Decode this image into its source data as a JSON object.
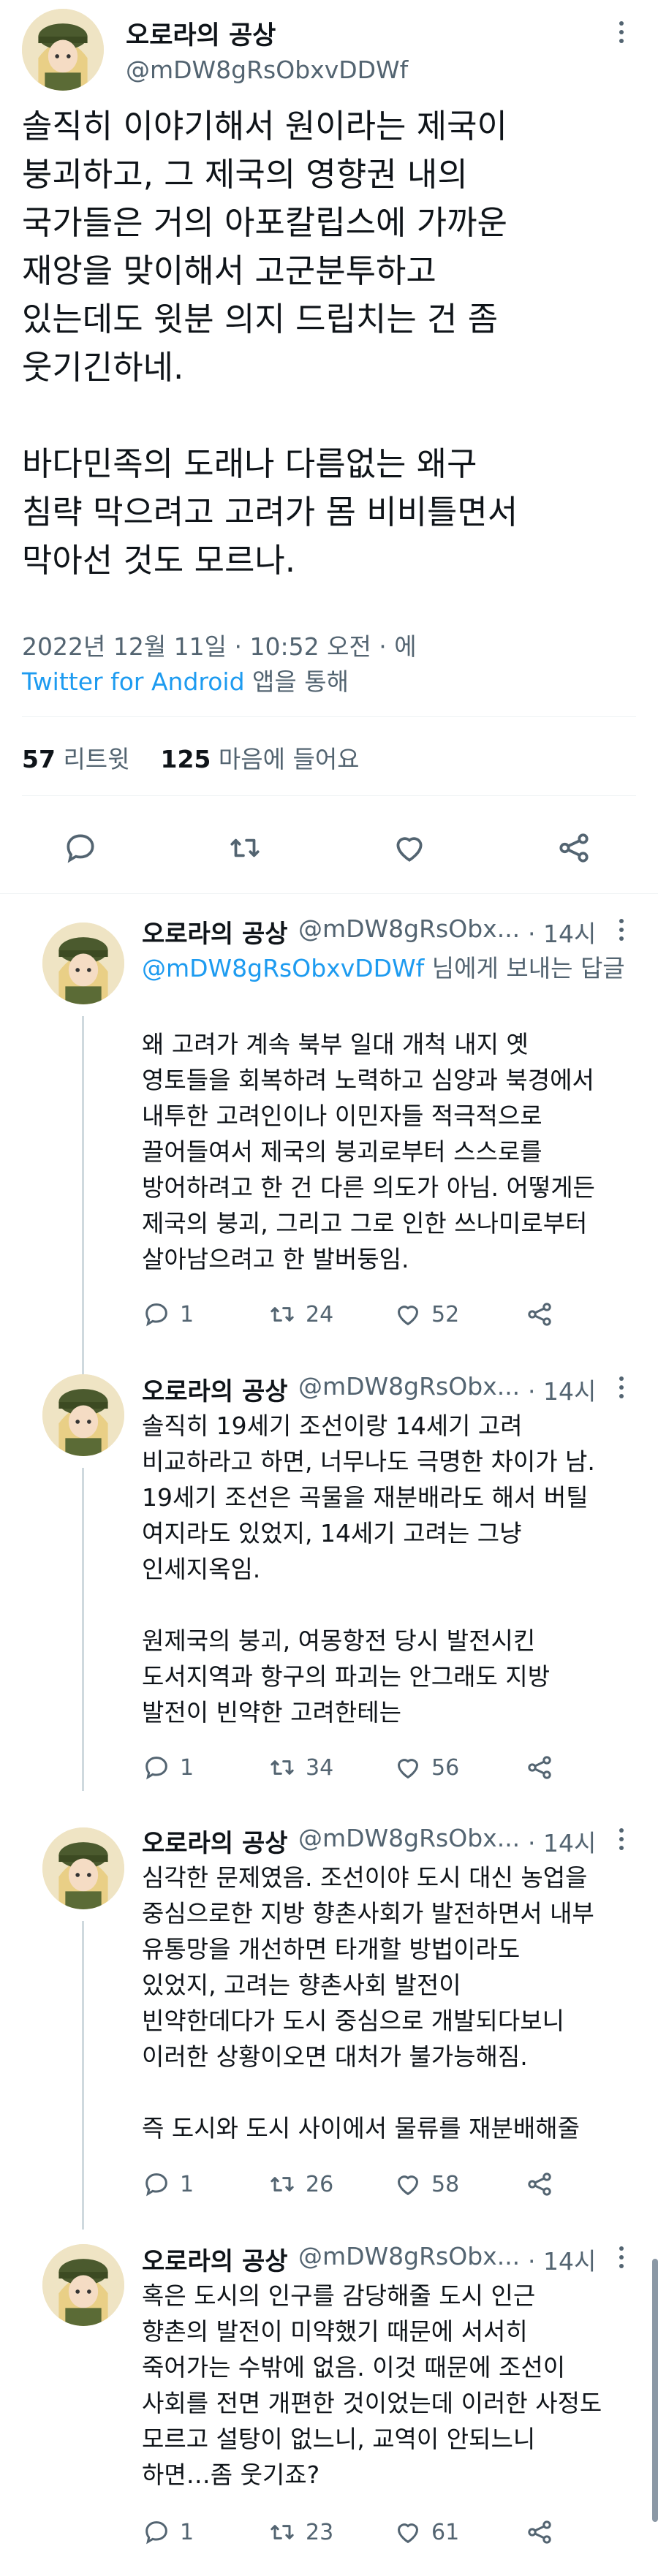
{
  "main": {
    "author_name": "오로라의 공상",
    "author_handle": "@mDW8gRsObxvDDWf",
    "text": "솔직히 이야기해서 원이라는 제국이\n붕괴하고, 그 제국의 영향권 내의\n국가들은 거의 아포칼립스에 가까운\n재앙을 맞이해서 고군분투하고\n있는데도 윗분 의지 드립치는 건 좀\n웃기긴하네.\n\n바다민족의 도래나 다름없는 왜구\n침략 막으려고 고려가 몸 비비틀면서\n막아선 것도 모르나.",
    "timestamp": "2022년 12월 11일 · 10:52 오전 · 에",
    "source": "Twitter for Android",
    "source_suffix": " 앱을 통해",
    "retweets": "57",
    "retweets_label": "리트윗",
    "likes": "125",
    "likes_label": "마음에 들어요"
  },
  "replies": [
    {
      "author_name": "오로라의 공상",
      "author_handle": "@mDW8gRsObx...",
      "time": "· 14시",
      "replying_mention": "@mDW8gRsObxvDDWf",
      "replying_suffix": " 님에게 보내는 답글",
      "text": "왜 고려가 계속 북부 일대 개척 내지 옛\n영토들을 회복하려 노력하고 심양과 북경에서\n내투한 고려인이나 이민자들 적극적으로\n끌어들여서 제국의 붕괴로부터 스스로를\n방어하려고 한 건 다른 의도가 아님. 어떻게든\n제국의 붕괴, 그리고 그로 인한 쓰나미로부터\n살아남으려고 한 발버둥임.",
      "reply_count": "1",
      "retweet_count": "24",
      "like_count": "52"
    },
    {
      "author_name": "오로라의 공상",
      "author_handle": "@mDW8gRsObx...",
      "time": "· 14시",
      "text": "솔직히 19세기 조선이랑 14세기 고려\n비교하라고 하면, 너무나도 극명한 차이가 남.\n19세기 조선은 곡물을 재분배라도 해서 버틸\n여지라도 있었지, 14세기 고려는 그냥\n인세지옥임.\n\n원제국의 붕괴, 여몽항전 당시 발전시킨\n도서지역과 항구의 파괴는 안그래도 지방\n발전이 빈약한 고려한테는",
      "reply_count": "1",
      "retweet_count": "34",
      "like_count": "56"
    },
    {
      "author_name": "오로라의 공상",
      "author_handle": "@mDW8gRsObx...",
      "time": "· 14시",
      "text": "심각한 문제였음. 조선이야 도시 대신 농업을\n중심으로한 지방 향촌사회가 발전하면서 내부\n유통망을 개선하면 타개할 방법이라도\n있었지, 고려는 향촌사회 발전이\n빈약한데다가 도시 중심으로 개발되다보니\n이러한 상황이오면 대처가 불가능해짐.\n\n즉 도시와 도시 사이에서 물류를 재분배해줄",
      "reply_count": "1",
      "retweet_count": "26",
      "like_count": "58"
    },
    {
      "author_name": "오로라의 공상",
      "author_handle": "@mDW8gRsObx...",
      "time": "· 14시",
      "text": "혹은 도시의 인구를 감당해줄 도시 인근\n향촌의 발전이 미약했기 때문에 서서히\n죽어가는 수밖에 없음. 이것 때문에 조선이\n사회를 전면 개편한 것이었는데 이러한 사정도\n모르고 설탕이 없느니, 교역이 안되느니\n하면…좀 웃기죠?",
      "reply_count": "1",
      "retweet_count": "23",
      "like_count": "61"
    }
  ]
}
